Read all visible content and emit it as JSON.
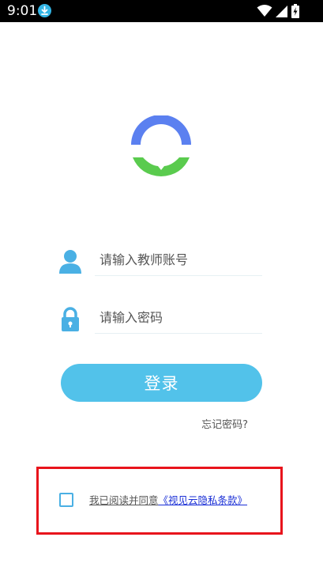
{
  "status_bar": {
    "time": "9:01",
    "icons": [
      "download-notification-icon",
      "wifi-icon",
      "cell-signal-icon",
      "battery-charging-icon"
    ]
  },
  "logo": {
    "top_color": "#5b80f0",
    "bottom_color": "#5acb4e"
  },
  "login_form": {
    "account_placeholder": "请输入教师账号",
    "password_placeholder": "请输入密码",
    "login_label": "登录",
    "forgot_password": "忘记密码?"
  },
  "agreement": {
    "text": "我已阅读并同意",
    "link": "《视见云隐私条款》",
    "checked": false
  },
  "colors": {
    "accent": "#52c2ea",
    "icon": "#4ab0e4",
    "link": "#1a2fd6",
    "highlight_border": "#e8141c"
  }
}
